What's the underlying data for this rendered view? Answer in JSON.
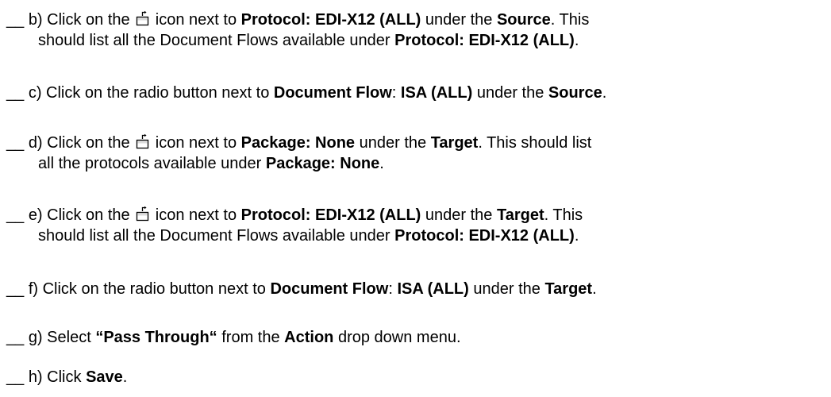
{
  "steps": [
    {
      "id": "b",
      "blank": "__",
      "marker": "b)",
      "t1": "Click on the",
      "icon": "folder-up-icon",
      "t2": "icon next to",
      "b1": "Protocol: EDI-X12 (ALL)",
      "t3": "under the",
      "b2": "Source",
      "t4": ". This",
      "l2a": "should list all the Document Flows available under",
      "l2b": "Protocol: EDI-X12 (ALL)",
      "l2c": "."
    },
    {
      "id": "c",
      "blank": "__",
      "marker": "c)",
      "t1": "Click on the radio button next to",
      "b1": "Document Flow",
      "t2": ":",
      "b2": "ISA (ALL)",
      "t3": "under the",
      "b3": "Source",
      "t4": "."
    },
    {
      "id": "d",
      "blank": "__",
      "marker": "d)",
      "t1": "Click on the",
      "icon": "folder-up-icon",
      "t2": "icon next to",
      "b1": "Package: None",
      "t3": "under the",
      "b2": "Target",
      "t4": ". This should list",
      "l2a": "all the protocols available under",
      "l2b": "Package: None",
      "l2c": "."
    },
    {
      "id": "e",
      "blank": "__",
      "marker": "e)",
      "t1": "Click on the",
      "icon": "folder-up-icon",
      "t2": "icon next to",
      "b1": "Protocol: EDI-X12 (ALL)",
      "t3": "under the",
      "b2": "Target",
      "t4": ". This",
      "l2a": "should list all the Document Flows available under",
      "l2b": "Protocol: EDI-X12 (ALL)",
      "l2c": "."
    },
    {
      "id": "f",
      "blank": "__",
      "marker": "f)",
      "t1": "Click on the radio button next to",
      "b1": "Document Flow",
      "t2": ":",
      "b2": "ISA (ALL)",
      "t3": "under the",
      "b3": "Target",
      "t4": "."
    },
    {
      "id": "g",
      "blank": "__",
      "marker": "g)",
      "t1": "Select",
      "b1": "“Pass Through“",
      "t2": "from the",
      "b2": "Action",
      "t3": "drop down menu."
    },
    {
      "id": "h",
      "blank": "__",
      "marker": "h)",
      "t1": "Click",
      "b1": "Save",
      "t2": "."
    }
  ]
}
